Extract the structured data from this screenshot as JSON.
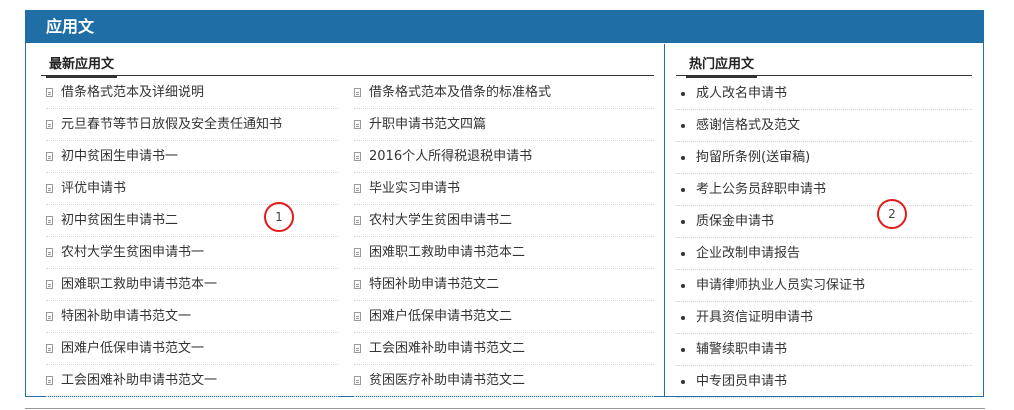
{
  "header": {
    "title": "应用文"
  },
  "latest": {
    "title": "最新应用文",
    "left_items": [
      "借条格式范本及详细说明",
      "元旦春节等节日放假及安全责任通知书",
      "初中贫困生申请书一",
      "评优申请书",
      "初中贫困生申请书二",
      "农村大学生贫困申请书一",
      "困难职工救助申请书范本一",
      "特困补助申请书范文一",
      "困难户低保申请书范文一",
      "工会困难补助申请书范文一"
    ],
    "right_items": [
      "借条格式范本及借条的标准格式",
      "升职申请书范文四篇",
      "2016个人所得税退税申请书",
      "毕业实习申请书",
      "农村大学生贫困申请书二",
      "困难职工救助申请书范本二",
      "特困补助申请书范文二",
      "困难户低保申请书范文二",
      "工会困难补助申请书范文二",
      "贫困医疗补助申请书范文二"
    ]
  },
  "hot": {
    "title": "热门应用文",
    "items": [
      "成人改名申请书",
      "感谢信格式及范文",
      "拘留所条例(送审稿)",
      "考上公务员辞职申请书",
      "质保金申请书",
      "企业改制申请报告",
      "申请律师执业人员实习保证书",
      "开具资信证明申请书",
      "辅警续职申请书",
      "中专团员申请书"
    ]
  },
  "annotations": {
    "marker1": "1",
    "marker2": "2"
  },
  "colors": {
    "header_bg": "#1f6ea5",
    "marker": "#e21b1b"
  }
}
